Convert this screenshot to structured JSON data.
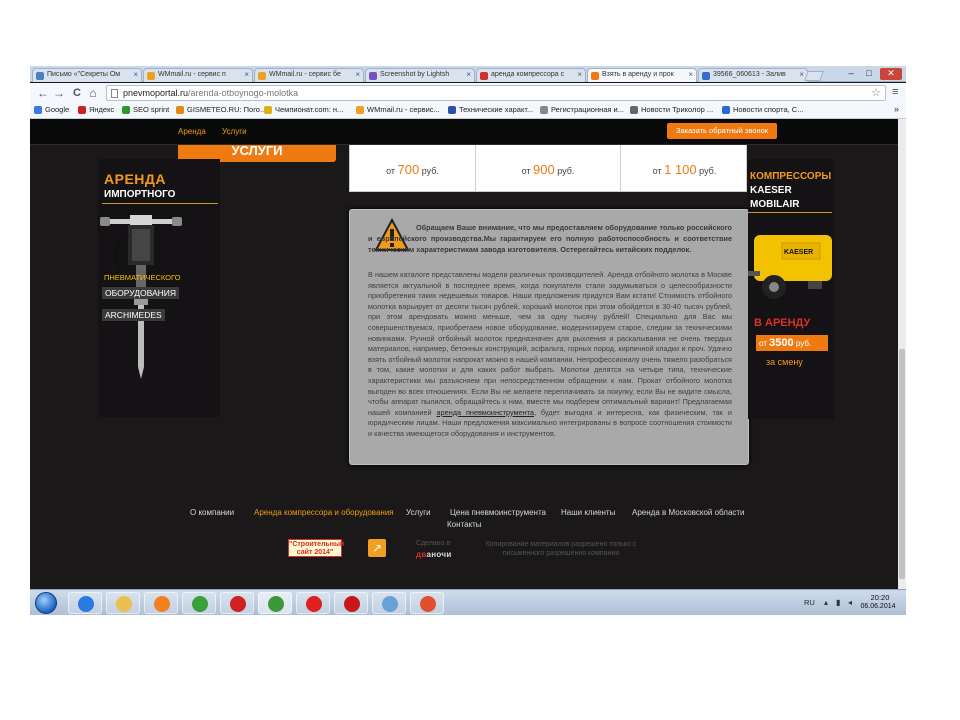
{
  "browser": {
    "tabs": [
      {
        "title": "Письмо «\"Секреты Ом",
        "color": "#4a7fc1"
      },
      {
        "title": "WMmail.ru - сервис п",
        "color": "#f0a020"
      },
      {
        "title": "WMmail.ru - сервис бе",
        "color": "#f0a020"
      },
      {
        "title": "Screenshot by Lightsh",
        "color": "#7a4fc1"
      },
      {
        "title": "аренда компрессора с",
        "color": "#d03030"
      },
      {
        "title": "Взять в аренду и прок",
        "color": "#f07a12"
      },
      {
        "title": "39566_060613 - Залив",
        "color": "#3a6ad0"
      }
    ],
    "close_glyph": "×",
    "window_controls": {
      "minimize": "–",
      "maximize": "□",
      "close": "✕"
    },
    "url": "pnevmoportal.ru/arenda-otboynogo-molotka",
    "url_host": "pnevmoportal.ru",
    "url_path": "/arenda-otboynogo-molotka",
    "nav": {
      "back": "←",
      "forward": "→",
      "reload": "C",
      "home": "⌂"
    },
    "star": "☆",
    "menu": "≡",
    "bookmarks": [
      {
        "label": "Google",
        "color": "#3a7be0"
      },
      {
        "label": "Яндекс",
        "color": "#d02020"
      },
      {
        "label": "SEO sprint",
        "color": "#2a9a2a"
      },
      {
        "label": "GISMETEO.RU: Пого...",
        "color": "#e08a10"
      },
      {
        "label": "Чемпионат.com: н...",
        "color": "#e0b010"
      },
      {
        "label": "WMmail.ru - сервис...",
        "color": "#f0a020"
      },
      {
        "label": "Технические характ...",
        "color": "#3050b0"
      },
      {
        "label": "Регистрационная и...",
        "color": "#888888"
      },
      {
        "label": "Новости Триколор ...",
        "color": "#666666"
      },
      {
        "label": "Новости спорта, С...",
        "color": "#2a6ad0"
      }
    ],
    "bookmarks_more": "»"
  },
  "site": {
    "nav_links": [
      "Аренда",
      "Услуги"
    ],
    "callback_button": "Заказать обратный звонок",
    "services_button": "УСЛУГИ",
    "left_banner": {
      "title": "АРЕНДА",
      "subtitle": "ИМПОРТНОГО",
      "pneumatic": "ПНЕВМАТИЧЕСКОГО",
      "equipment": "ОБОРУДОВАНИЯ",
      "brand": "ARCHIMEDES"
    },
    "prices": [
      {
        "prefix": "от",
        "value": "700",
        "suffix": "руб."
      },
      {
        "prefix": "от",
        "value": "900",
        "suffix": "руб."
      },
      {
        "prefix": "от",
        "value": "1 100",
        "suffix": "руб."
      }
    ],
    "notice": {
      "warning": "Обращаем Ваше внимание, что мы предоставляем оборудование только российского и европейского производства.Мы гарантируем его полную работоспособность и соответствие техническим характеристикам завода изготовителя. Остерегайтесь китайских подделок.",
      "body_before_link": "В нашем каталоге представлены модели различных производителей. Аренда отбойного молотка в Москве является актуальной в последнее время, когда покупатели стали задумываться о целесообразности приобретения таких недешевых товаров. Наши предложения придутся Вам кстати! Стоимость отбойного молотка варьирует от десяти тысяч рублей, хороший молоток при этом обойдется в 30-40 тысяч рублей, при этом арендовать можно меньше, чем за одну тысячу рублей! Специально для Вас мы совершенствуемся, приобретаем новое оборудование, модернизируем старое, следим за техническими новинками. Ручной отбойный молоток предназначен для рыхления и раскалывания не очень твердых материалов, например, бетонных конструкций, асфальта, горных пород, кирпичной кладки и проч. Удачно взять отбойный молоток напрокат можно в нашей компании. Непрофессионалу очень тяжело разобраться в том, какие молотки и для каких работ выбрать. Молотки делятся на четыре типа, технические характеристики мы разъясняем при непосредственном обращении к нам. Прокат отбойного молотка выгоден во всех отношениях. Если Вы не желаете переплачивать за покупку, если Вы не видите смысла, чтобы аппарат пылился, обращайтесь к нам, вместе мы подберем оптимальный вариант! Предлагаемая нашей компанией ",
      "link_text": "аренда пневмоинструмента",
      "body_after_link": ", будет выгодна и интересна, как физическим, так и юридическим лицам. Наши предложения максимально интегрированы в вопросе соотношения стоимости и качества имеющегося оборудования и инструментов."
    },
    "right_banner": {
      "line1": "КОМПРЕССОРЫ",
      "line2": "KAESER",
      "line3": "MOBILAIR",
      "rent": "В АРЕНДУ",
      "price_prefix": "от",
      "price_value": "3500",
      "price_suffix": "руб.",
      "per_shift": "за смену",
      "machine_brand": "KAESER"
    },
    "footer": {
      "links": [
        "О компании",
        "Аренда компрессора и оборудования",
        "Услуги",
        "Цена пневмоинструмента",
        "Наши клиенты",
        "Аренда в Московской области"
      ],
      "contacts": "Контакты",
      "badge_line1": "\"Строительный",
      "badge_line2": "сайт 2014\"",
      "arrow": "↗",
      "made_label": "Сделано в",
      "made_brand_red": "дв",
      "made_brand_rest": "аночи",
      "copyright": "Копирование материалов разрешено только с письменного разрешения компании"
    }
  },
  "taskbar": {
    "apps": [
      {
        "name": "internet-explorer",
        "color": "#2a7be0"
      },
      {
        "name": "file-explorer",
        "color": "#e8c050"
      },
      {
        "name": "media-player",
        "color": "#f08020"
      },
      {
        "name": "utorrent",
        "color": "#3aa03a"
      },
      {
        "name": "opera",
        "color": "#d02020"
      },
      {
        "name": "chrome",
        "color": "#3a9a3a"
      },
      {
        "name": "yandex",
        "color": "#e02020"
      },
      {
        "name": "opera-red",
        "color": "#c81818"
      },
      {
        "name": "app-blue",
        "color": "#6aa0d8"
      },
      {
        "name": "app-orange",
        "color": "#e05030"
      }
    ],
    "language": "RU",
    "time": "20:20",
    "date": "06.06.2014"
  }
}
